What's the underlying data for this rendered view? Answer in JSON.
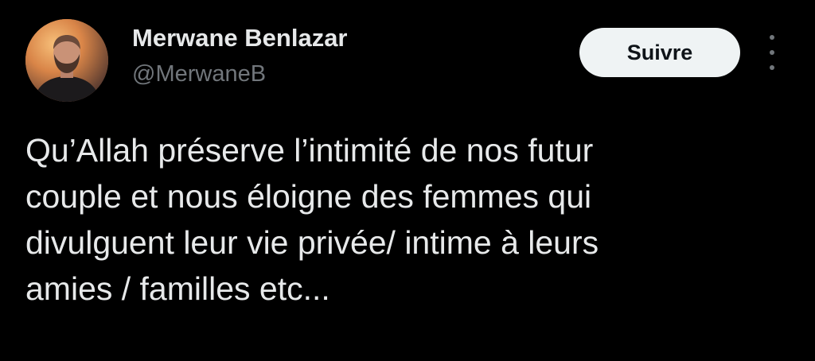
{
  "author": {
    "name": "Merwane Benlazar",
    "handle": "@MerwaneB",
    "avatar_icon": "profile-photo"
  },
  "actions": {
    "follow_label": "Suivre",
    "more_icon": "more-vertical-icon"
  },
  "tweet": {
    "lines": [
      "Qu’Allah préserve l’intimité de nos futur",
      "couple et nous éloigne des femmes qui",
      "divulguent leur vie privée/ intime à leurs",
      "amies / familles etc..."
    ]
  },
  "colors": {
    "background": "#000000",
    "text_primary": "#e7e9ea",
    "text_secondary": "#71767b",
    "button_bg": "#eff3f4",
    "button_text": "#0f1419"
  }
}
